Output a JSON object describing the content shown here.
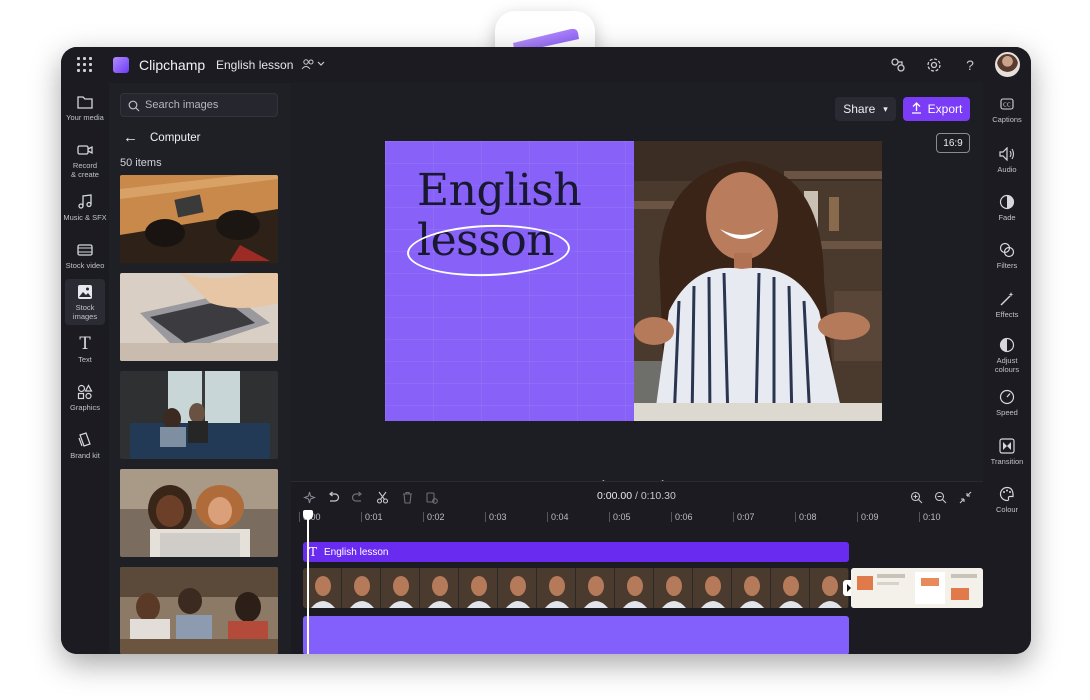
{
  "app": {
    "name": "Clipchamp",
    "project_name": "English lesson"
  },
  "topbar": {
    "icons": [
      "waffle-icon",
      "clipchamp-logo-icon",
      "collab-icon",
      "settings-icon",
      "help-icon",
      "user-avatar"
    ]
  },
  "left_rail": [
    {
      "label": "Your media",
      "icon": "folder-icon"
    },
    {
      "label": "Record\n& create",
      "icon": "camera-icon"
    },
    {
      "label": "Music & SFX",
      "icon": "music-icon"
    },
    {
      "label": "Stock video",
      "icon": "film-icon"
    },
    {
      "label": "Stock\nimages",
      "icon": "image-icon",
      "active": true
    },
    {
      "label": "Text",
      "icon": "text-icon"
    },
    {
      "label": "Graphics",
      "icon": "shapes-icon"
    },
    {
      "label": "Brand kit",
      "icon": "brand-kit-icon"
    }
  ],
  "media_panel": {
    "search_placeholder": "Search images",
    "folder": "Computer",
    "count": "50 items"
  },
  "stage": {
    "share_label": "Share",
    "export_label": "Export",
    "aspect_ratio": "16:9",
    "title_line1": "English",
    "title_line2": "lesson",
    "accent_color": "#7b3cf7",
    "canvas_color": "#8761f8"
  },
  "right_rail": [
    {
      "label": "Captions",
      "icon": "cc-icon"
    },
    {
      "label": "Audio",
      "icon": "speaker-icon"
    },
    {
      "label": "Fade",
      "icon": "fade-icon"
    },
    {
      "label": "Filters",
      "icon": "filters-icon"
    },
    {
      "label": "Effects",
      "icon": "effects-icon"
    },
    {
      "label": "Adjust\ncolours",
      "icon": "adjust-colours-icon"
    },
    {
      "label": "Speed",
      "icon": "speed-icon"
    },
    {
      "label": "Transition",
      "icon": "transition-icon"
    },
    {
      "label": "Colour",
      "icon": "colour-icon"
    }
  ],
  "timeline": {
    "current_time": "0:00.00",
    "total_time": "0:10.30",
    "ticks": [
      "0:00",
      "0:01",
      "0:02",
      "0:03",
      "0:04",
      "0:05",
      "0:06",
      "0:07",
      "0:08",
      "0:09",
      "0:10"
    ],
    "text_clip_label": "English lesson"
  }
}
